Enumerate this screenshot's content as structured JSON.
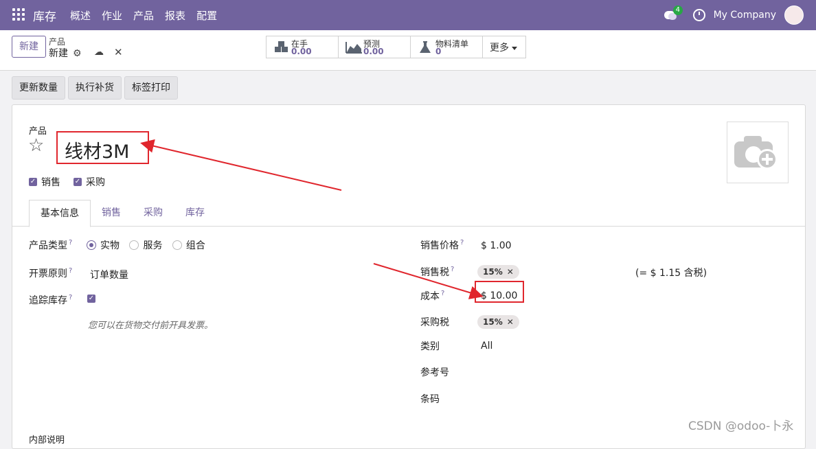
{
  "navbar": {
    "brand": "库存",
    "menu": [
      "概述",
      "作业",
      "产品",
      "报表",
      "配置"
    ],
    "chat_badge": "4",
    "company": "My Company"
  },
  "control": {
    "new_label": "新建",
    "breadcrumb_parent": "产品",
    "breadcrumb_current": "新建",
    "stats": [
      {
        "label": "在手",
        "value": "0.00",
        "icon": "cubes-icon"
      },
      {
        "label": "预测",
        "value": "0.00",
        "icon": "area-chart-icon"
      },
      {
        "label": "物料清单",
        "value": "0",
        "icon": "flask-icon"
      }
    ],
    "more_label": "更多"
  },
  "statusbar": {
    "buttons": [
      "更新数量",
      "执行补货",
      "标签打印"
    ]
  },
  "form": {
    "name_label": "产品",
    "name_value": "线材3M",
    "checks": {
      "sale": "销售",
      "purchase": "采购"
    },
    "tabs": [
      "基本信息",
      "销售",
      "采购",
      "库存"
    ],
    "left": {
      "product_type_label": "产品类型",
      "product_type_options": [
        "实物",
        "服务",
        "组合"
      ],
      "invoice_policy_label": "开票原则",
      "invoice_policy_value": "订单数量",
      "track_inventory_label": "追踪库存",
      "hint": "您可以在货物交付前开具发票。"
    },
    "right": {
      "sale_price_label": "销售价格",
      "sale_price_value": "$ 1.00",
      "sale_tax_label": "销售税",
      "sale_tax_tag": "15%",
      "sale_tax_incl": "(= $ 1.15 含税)",
      "cost_label": "成本",
      "cost_value": "$ 10.00",
      "purchase_tax_label": "采购税",
      "purchase_tax_tag": "15%",
      "category_label": "类别",
      "category_value": "All",
      "reference_label": "参考号",
      "barcode_label": "条码"
    },
    "section_cut": "内部说明"
  },
  "watermark": "CSDN @odoo-卜永",
  "colors": {
    "primary": "#71639e",
    "annotation": "#e0262d"
  }
}
